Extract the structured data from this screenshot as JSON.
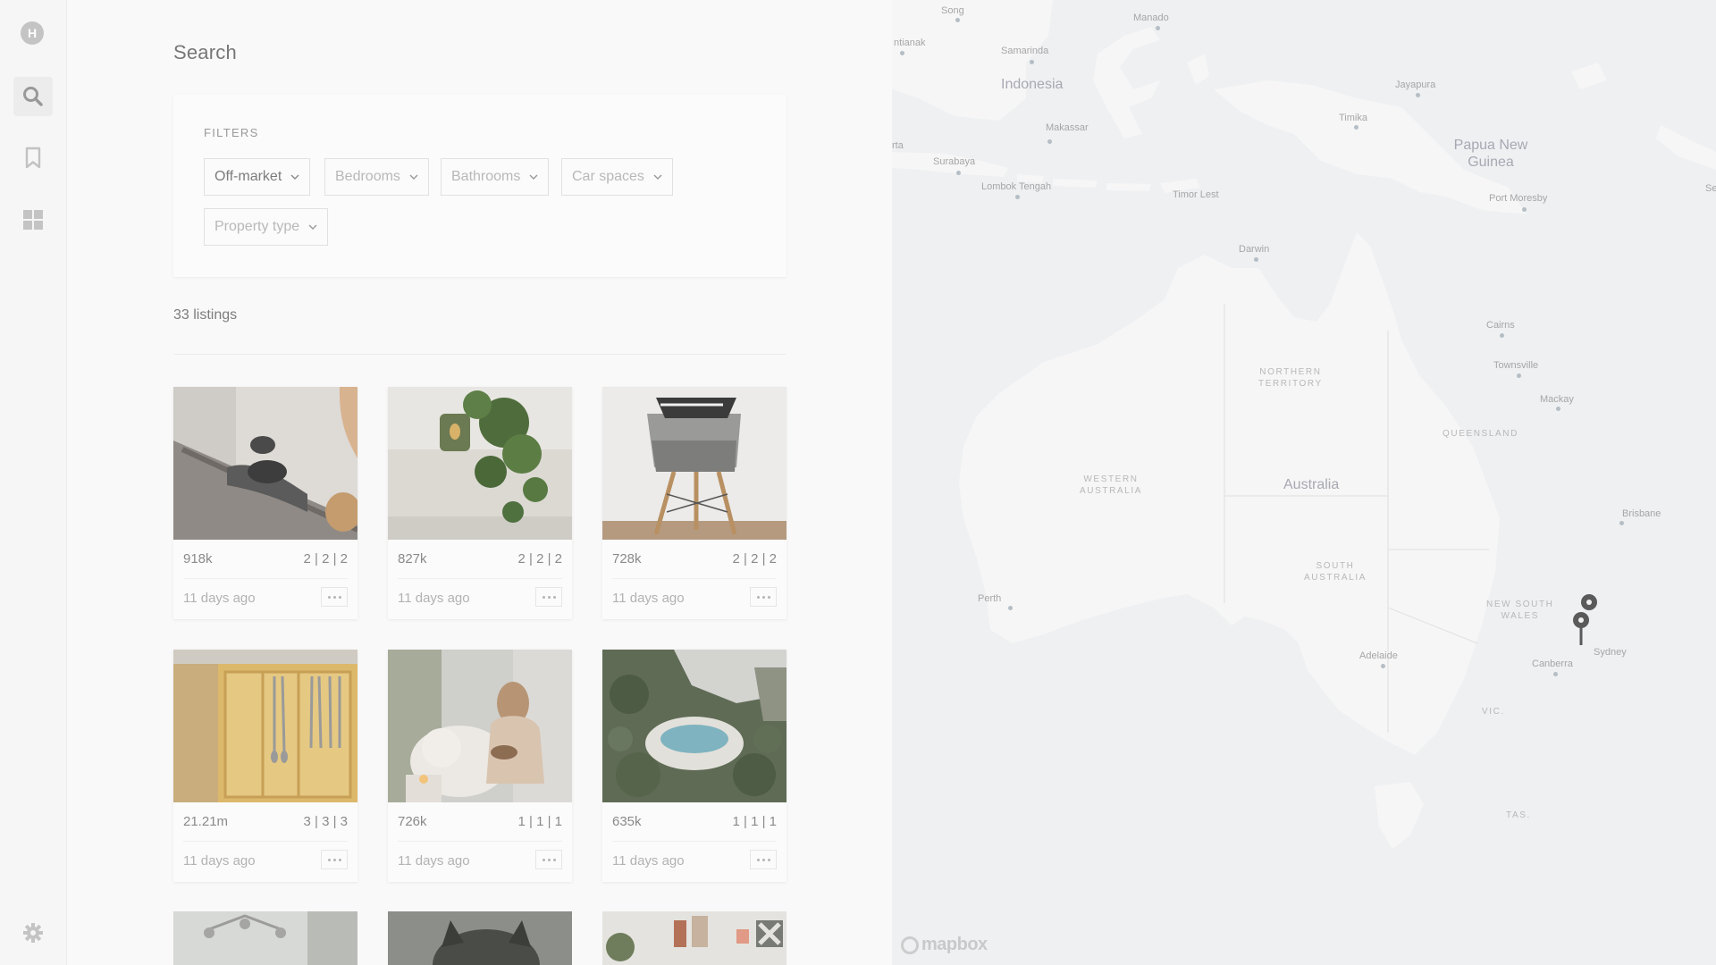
{
  "sidebar": {
    "logo_letter": "H",
    "nav": [
      "search-icon",
      "bookmark-icon",
      "grid-icon"
    ],
    "footer_icon": "gear-icon"
  },
  "search": {
    "title": "Search",
    "filters_heading": "FILTERS",
    "filters": [
      {
        "label": "Off-market",
        "selected": true
      },
      {
        "label": "Bedrooms",
        "selected": false
      },
      {
        "label": "Bathrooms",
        "selected": false
      },
      {
        "label": "Car spaces",
        "selected": false
      },
      {
        "label": "Property type",
        "selected": false
      }
    ],
    "listing_count": "33 listings"
  },
  "listings": [
    {
      "price": "918k",
      "rooms": "2 | 2 | 2",
      "age": "11 days ago",
      "photo": "hammock"
    },
    {
      "price": "827k",
      "rooms": "2 | 2 | 2",
      "age": "11 days ago",
      "photo": "plant-candle"
    },
    {
      "price": "728k",
      "rooms": "2 | 2 | 2",
      "age": "11 days ago",
      "photo": "chair-sneakers"
    },
    {
      "price": "21.21m",
      "rooms": "3 | 3 | 3",
      "age": "11 days ago",
      "photo": "cutlery-drawer"
    },
    {
      "price": "726k",
      "rooms": "1 | 1 | 1",
      "age": "11 days ago",
      "photo": "woman-dog"
    },
    {
      "price": "635k",
      "rooms": "1 | 1 | 1",
      "age": "11 days ago",
      "photo": "pool-aerial"
    }
  ],
  "map": {
    "countries": {
      "indonesia": "Indonesia",
      "png": "Papua New Guinea",
      "australia": "Australia",
      "timor": "Timor Lest"
    },
    "states": {
      "nt": "NORTHERN\nTERRITORY",
      "wa": "WESTERN\nAUSTRALIA",
      "qld": "QUEENSLAND",
      "sa": "SOUTH\nAUSTRALIA",
      "nsw": "NEW SOUTH\nWALES",
      "vic": "VIC.",
      "tas": "TAS."
    },
    "cities": {
      "song": "Song",
      "manado": "Manado",
      "pontianak": "ntianak",
      "samarinda": "Samarinda",
      "jayapura": "Jayapura",
      "timika": "Timika",
      "makassar": "Makassar",
      "rta": "rta",
      "surabaya": "Surabaya",
      "lombok": "Lombok Tengah",
      "port_moresby": "Port Moresby",
      "se": "Se",
      "darwin": "Darwin",
      "cairns": "Cairns",
      "townsville": "Townsville",
      "mackay": "Mackay",
      "brisbane": "Brisbane",
      "perth": "Perth",
      "adelaide": "Adelaide",
      "canberra": "Canberra",
      "sydney": "Sydney"
    },
    "attribution": "mapbox"
  }
}
